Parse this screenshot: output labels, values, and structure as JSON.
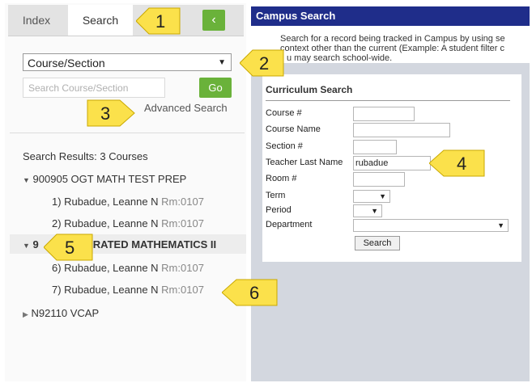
{
  "tabs": [
    {
      "label": "Index",
      "active": false
    },
    {
      "label": "Search",
      "active": true
    }
  ],
  "back_button_icon": "chevron-left-icon",
  "search_type": "Course/Section",
  "search_placeholder": "Search Course/Section",
  "go_label": "Go",
  "advanced_search_label": "Advanced Search",
  "results": {
    "header": "Search Results: 3 Courses",
    "courses": [
      {
        "name": "900905 OGT MATH TEST PREP",
        "expanded": true,
        "sections": [
          {
            "label": "1) Rubadue, Leanne N",
            "room": "Rm:0107"
          },
          {
            "label": "2) Rubadue, Leanne N",
            "room": "Rm:0107"
          }
        ]
      },
      {
        "name_prefix": "9",
        "name": "EGRATED MATHEMATICS II",
        "expanded": true,
        "selected": true,
        "sections": [
          {
            "label": "6) Rubadue, Leanne N",
            "room": "Rm:0107"
          },
          {
            "label": "7) Rubadue, Leanne N",
            "room": "Rm:0107"
          }
        ]
      },
      {
        "name": "N92110 VCAP",
        "expanded": false,
        "sections": []
      }
    ]
  },
  "campus_search": {
    "title": "Campus Search",
    "description_lines": [
      "Search for a record being tracked in Campus by using se",
      "context other than the current (Example: A student filter c",
      "u may search school-wide."
    ],
    "form_title": "Curriculum Search",
    "fields": [
      {
        "label": "Course #",
        "value": ""
      },
      {
        "label": "Course Name",
        "value": ""
      },
      {
        "label": "Section #",
        "value": ""
      },
      {
        "label": "Teacher Last Name",
        "value": "rubadue"
      },
      {
        "label": "Room #",
        "value": ""
      },
      {
        "label": "Term",
        "value": ""
      },
      {
        "label": "Period",
        "value": ""
      },
      {
        "label": "Department",
        "value": ""
      }
    ],
    "search_button": "Search"
  },
  "callouts": [
    "1",
    "2",
    "3",
    "4",
    "5",
    "6"
  ],
  "colors": {
    "accent_green": "#6ab23a",
    "header_navy": "#1f2d8a",
    "callout_yellow": "#fbe14b"
  }
}
